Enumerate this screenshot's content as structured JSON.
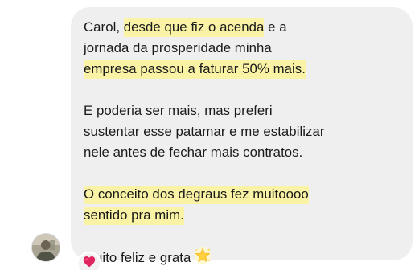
{
  "message": {
    "para1": {
      "l1_a": "Carol, ",
      "l1_hl": "desde que fiz o acenda",
      "l1_b": " e a",
      "l2": "jornada da prosperidade minha",
      "l3_hl": "empresa passou a faturar 50% mais."
    },
    "para2": {
      "l1": "E poderia ser mais, mas preferi",
      "l2": "sustentar esse patamar e me estabilizar",
      "l3": "nele antes de fechar mais contratos."
    },
    "para3": {
      "l1_hl": "O conceito dos degraus fez muitoooo",
      "l2_hl": "sentido pra mim."
    },
    "para4": {
      "l1": "Muito feliz e grata"
    }
  },
  "icons": {
    "star": "glowing-star-emoji",
    "reaction": "red-heart-emoji",
    "avatar": "user-avatar"
  },
  "colors": {
    "bubble": "#efefef",
    "highlight": "#faf3a6",
    "text": "#1a1a1a",
    "heart": "#e0245e"
  }
}
